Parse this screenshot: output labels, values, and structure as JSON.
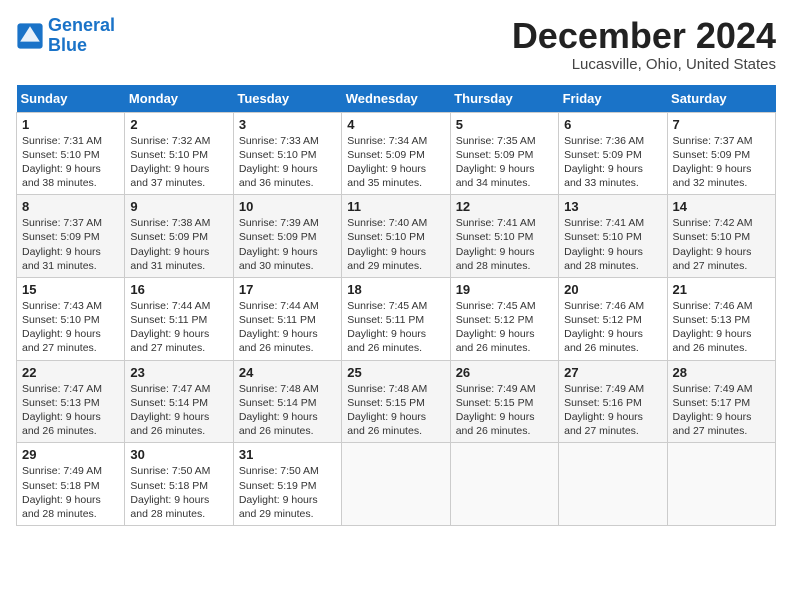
{
  "header": {
    "logo_line1": "General",
    "logo_line2": "Blue",
    "month_title": "December 2024",
    "location": "Lucasville, Ohio, United States"
  },
  "weekdays": [
    "Sunday",
    "Monday",
    "Tuesday",
    "Wednesday",
    "Thursday",
    "Friday",
    "Saturday"
  ],
  "weeks": [
    [
      {
        "day": "1",
        "sunrise": "Sunrise: 7:31 AM",
        "sunset": "Sunset: 5:10 PM",
        "daylight": "Daylight: 9 hours and 38 minutes."
      },
      {
        "day": "2",
        "sunrise": "Sunrise: 7:32 AM",
        "sunset": "Sunset: 5:10 PM",
        "daylight": "Daylight: 9 hours and 37 minutes."
      },
      {
        "day": "3",
        "sunrise": "Sunrise: 7:33 AM",
        "sunset": "Sunset: 5:10 PM",
        "daylight": "Daylight: 9 hours and 36 minutes."
      },
      {
        "day": "4",
        "sunrise": "Sunrise: 7:34 AM",
        "sunset": "Sunset: 5:09 PM",
        "daylight": "Daylight: 9 hours and 35 minutes."
      },
      {
        "day": "5",
        "sunrise": "Sunrise: 7:35 AM",
        "sunset": "Sunset: 5:09 PM",
        "daylight": "Daylight: 9 hours and 34 minutes."
      },
      {
        "day": "6",
        "sunrise": "Sunrise: 7:36 AM",
        "sunset": "Sunset: 5:09 PM",
        "daylight": "Daylight: 9 hours and 33 minutes."
      },
      {
        "day": "7",
        "sunrise": "Sunrise: 7:37 AM",
        "sunset": "Sunset: 5:09 PM",
        "daylight": "Daylight: 9 hours and 32 minutes."
      }
    ],
    [
      {
        "day": "8",
        "sunrise": "Sunrise: 7:37 AM",
        "sunset": "Sunset: 5:09 PM",
        "daylight": "Daylight: 9 hours and 31 minutes."
      },
      {
        "day": "9",
        "sunrise": "Sunrise: 7:38 AM",
        "sunset": "Sunset: 5:09 PM",
        "daylight": "Daylight: 9 hours and 31 minutes."
      },
      {
        "day": "10",
        "sunrise": "Sunrise: 7:39 AM",
        "sunset": "Sunset: 5:09 PM",
        "daylight": "Daylight: 9 hours and 30 minutes."
      },
      {
        "day": "11",
        "sunrise": "Sunrise: 7:40 AM",
        "sunset": "Sunset: 5:10 PM",
        "daylight": "Daylight: 9 hours and 29 minutes."
      },
      {
        "day": "12",
        "sunrise": "Sunrise: 7:41 AM",
        "sunset": "Sunset: 5:10 PM",
        "daylight": "Daylight: 9 hours and 28 minutes."
      },
      {
        "day": "13",
        "sunrise": "Sunrise: 7:41 AM",
        "sunset": "Sunset: 5:10 PM",
        "daylight": "Daylight: 9 hours and 28 minutes."
      },
      {
        "day": "14",
        "sunrise": "Sunrise: 7:42 AM",
        "sunset": "Sunset: 5:10 PM",
        "daylight": "Daylight: 9 hours and 27 minutes."
      }
    ],
    [
      {
        "day": "15",
        "sunrise": "Sunrise: 7:43 AM",
        "sunset": "Sunset: 5:10 PM",
        "daylight": "Daylight: 9 hours and 27 minutes."
      },
      {
        "day": "16",
        "sunrise": "Sunrise: 7:44 AM",
        "sunset": "Sunset: 5:11 PM",
        "daylight": "Daylight: 9 hours and 27 minutes."
      },
      {
        "day": "17",
        "sunrise": "Sunrise: 7:44 AM",
        "sunset": "Sunset: 5:11 PM",
        "daylight": "Daylight: 9 hours and 26 minutes."
      },
      {
        "day": "18",
        "sunrise": "Sunrise: 7:45 AM",
        "sunset": "Sunset: 5:11 PM",
        "daylight": "Daylight: 9 hours and 26 minutes."
      },
      {
        "day": "19",
        "sunrise": "Sunrise: 7:45 AM",
        "sunset": "Sunset: 5:12 PM",
        "daylight": "Daylight: 9 hours and 26 minutes."
      },
      {
        "day": "20",
        "sunrise": "Sunrise: 7:46 AM",
        "sunset": "Sunset: 5:12 PM",
        "daylight": "Daylight: 9 hours and 26 minutes."
      },
      {
        "day": "21",
        "sunrise": "Sunrise: 7:46 AM",
        "sunset": "Sunset: 5:13 PM",
        "daylight": "Daylight: 9 hours and 26 minutes."
      }
    ],
    [
      {
        "day": "22",
        "sunrise": "Sunrise: 7:47 AM",
        "sunset": "Sunset: 5:13 PM",
        "daylight": "Daylight: 9 hours and 26 minutes."
      },
      {
        "day": "23",
        "sunrise": "Sunrise: 7:47 AM",
        "sunset": "Sunset: 5:14 PM",
        "daylight": "Daylight: 9 hours and 26 minutes."
      },
      {
        "day": "24",
        "sunrise": "Sunrise: 7:48 AM",
        "sunset": "Sunset: 5:14 PM",
        "daylight": "Daylight: 9 hours and 26 minutes."
      },
      {
        "day": "25",
        "sunrise": "Sunrise: 7:48 AM",
        "sunset": "Sunset: 5:15 PM",
        "daylight": "Daylight: 9 hours and 26 minutes."
      },
      {
        "day": "26",
        "sunrise": "Sunrise: 7:49 AM",
        "sunset": "Sunset: 5:15 PM",
        "daylight": "Daylight: 9 hours and 26 minutes."
      },
      {
        "day": "27",
        "sunrise": "Sunrise: 7:49 AM",
        "sunset": "Sunset: 5:16 PM",
        "daylight": "Daylight: 9 hours and 27 minutes."
      },
      {
        "day": "28",
        "sunrise": "Sunrise: 7:49 AM",
        "sunset": "Sunset: 5:17 PM",
        "daylight": "Daylight: 9 hours and 27 minutes."
      }
    ],
    [
      {
        "day": "29",
        "sunrise": "Sunrise: 7:49 AM",
        "sunset": "Sunset: 5:18 PM",
        "daylight": "Daylight: 9 hours and 28 minutes."
      },
      {
        "day": "30",
        "sunrise": "Sunrise: 7:50 AM",
        "sunset": "Sunset: 5:18 PM",
        "daylight": "Daylight: 9 hours and 28 minutes."
      },
      {
        "day": "31",
        "sunrise": "Sunrise: 7:50 AM",
        "sunset": "Sunset: 5:19 PM",
        "daylight": "Daylight: 9 hours and 29 minutes."
      },
      null,
      null,
      null,
      null
    ]
  ]
}
